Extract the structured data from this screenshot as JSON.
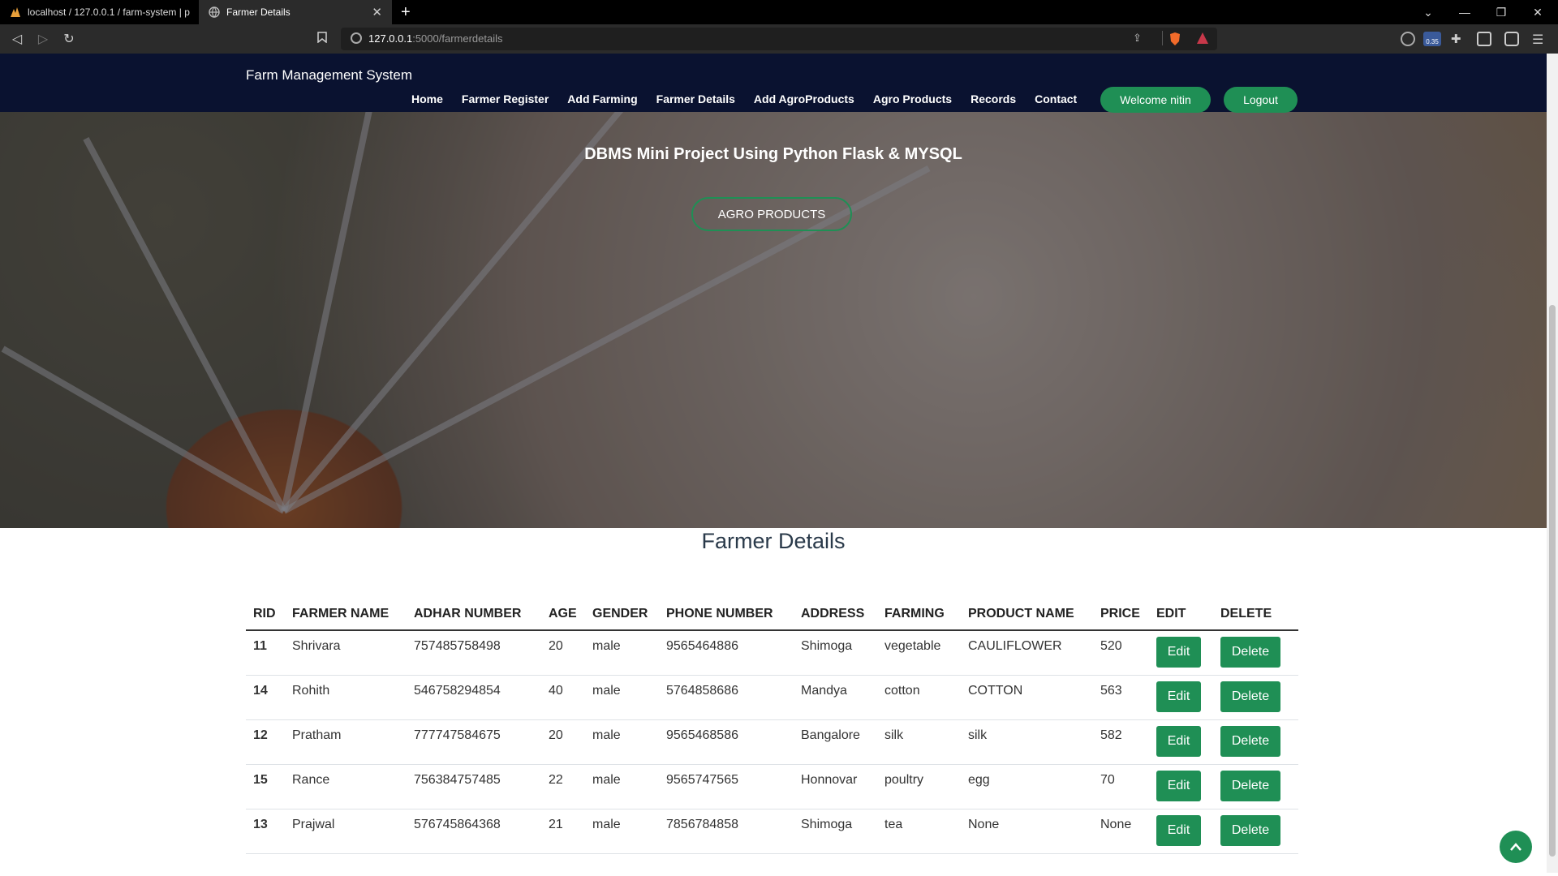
{
  "browser": {
    "tabs": [
      {
        "title": "localhost / 127.0.0.1 / farm-system | p",
        "active": false
      },
      {
        "title": "Farmer Details",
        "active": true
      }
    ],
    "url_host": "127.0.0.1",
    "url_path": ":5000/farmerdetails",
    "ext_badge": "0.35"
  },
  "navbar": {
    "brand": "Farm Management System",
    "links": [
      "Home",
      "Farmer Register",
      "Add Farming",
      "Farmer Details",
      "Add AgroProducts",
      "Agro Products",
      "Records",
      "Contact"
    ],
    "welcome": "Welcome nitin",
    "logout": "Logout"
  },
  "hero": {
    "subtitle": "DBMS Mini Project Using Python Flask & MYSQL",
    "button": "AGRO PRODUCTS"
  },
  "section": {
    "title": "Farmer Details"
  },
  "table": {
    "headers": [
      "RID",
      "FARMER NAME",
      "ADHAR NUMBER",
      "AGE",
      "GENDER",
      "PHONE NUMBER",
      "ADDRESS",
      "FARMING",
      "PRODUCT NAME",
      "PRICE",
      "EDIT",
      "DELETE"
    ],
    "edit_label": "Edit",
    "delete_label": "Delete",
    "rows": [
      [
        "11",
        "Shrivara",
        "757485758498",
        "20",
        "male",
        "9565464886",
        "Shimoga",
        "vegetable",
        "CAULIFLOWER",
        "520"
      ],
      [
        "14",
        "Rohith",
        "546758294854",
        "40",
        "male",
        "5764858686",
        "Mandya",
        "cotton",
        "COTTON",
        "563"
      ],
      [
        "12",
        "Pratham",
        "777747584675",
        "20",
        "male",
        "9565468586",
        "Bangalore",
        "silk",
        "silk",
        "582"
      ],
      [
        "15",
        "Rance",
        "756384757485",
        "22",
        "male",
        "9565747565",
        "Honnovar",
        "poultry",
        "egg",
        "70"
      ],
      [
        "13",
        "Prajwal",
        "576745864368",
        "21",
        "male",
        "7856784858",
        "Shimoga",
        "tea",
        "None",
        "None"
      ]
    ]
  },
  "colors": {
    "accent": "#1f8f55",
    "navbar": "#0a1230"
  }
}
